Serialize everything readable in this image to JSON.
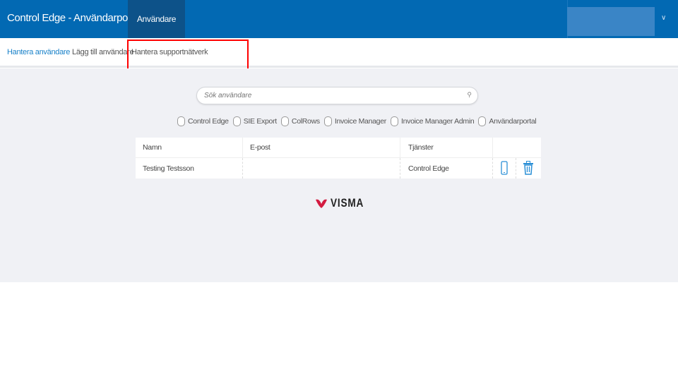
{
  "header": {
    "title": "Control Edge - Användarportal",
    "tab": "Användare"
  },
  "subnav": {
    "items": [
      "Hantera användare",
      "Lägg till användare",
      "Hantera supportnätverk"
    ]
  },
  "search": {
    "placeholder": "Sök användare",
    "value": ""
  },
  "filters": [
    "Control Edge",
    "SIE Export",
    "ColRows",
    "Invoice Manager",
    "Invoice Manager Admin",
    "Användarportal"
  ],
  "table": {
    "headers": [
      "Namn",
      "E-post",
      "Tjänster"
    ],
    "rows": [
      {
        "name": "Testing Testsson",
        "email": "",
        "services": "Control Edge"
      }
    ]
  },
  "logo": "VISMA",
  "colors": {
    "header": "#0269b3",
    "accent": "#1a82c9",
    "highlight": "#ff0000",
    "logo_red": "#d31b40"
  }
}
